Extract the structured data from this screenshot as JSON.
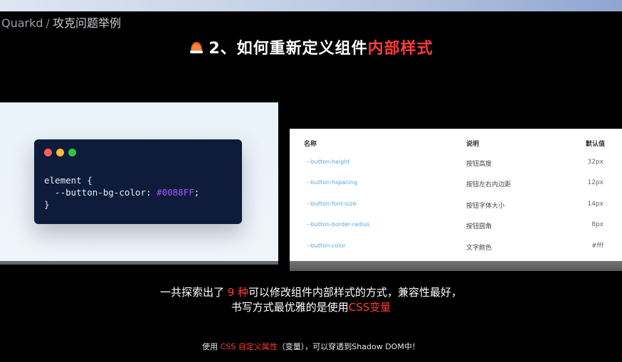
{
  "breadcrumb": {
    "root": "Quarkd",
    "separator": "/",
    "current": "攻克问题举例"
  },
  "title": {
    "prefix": "2、如何重新定义组件",
    "highlight": "内部样式"
  },
  "code_card": {
    "line1": "element {",
    "line2_prop": "  --button-bg-color: ",
    "line2_value": "#0088FF",
    "line2_end": ";",
    "line3": "}"
  },
  "table": {
    "headers": {
      "name": "名称",
      "desc": "说明",
      "default": "默认值"
    },
    "rows": [
      {
        "name": "--button-height",
        "desc": "按钮高度",
        "default": "32px"
      },
      {
        "name": "--button-hspacing",
        "desc": "按钮左右内边距",
        "default": "12px"
      },
      {
        "name": "--button-font-size",
        "desc": "按钮字体大小",
        "default": "14px"
      },
      {
        "name": "--button-border-radius",
        "desc": "按钮圆角",
        "default": "8px"
      },
      {
        "name": "--button-color",
        "desc": "文字颜色",
        "default": "#fff"
      }
    ]
  },
  "subtitle": {
    "line1_a": "一共探索出了 ",
    "line1_highlight": "9 种",
    "line1_b": "可以修改组件内部样式的方式，兼容性最好，",
    "line2_a": "书写方式最优雅的是使用",
    "line2_highlight": "CSS变量"
  },
  "caption": {
    "a": "使用 ",
    "highlight": "CSS 自定义属性",
    "b": "（变量），可以穿透到Shadow DOM中！"
  },
  "colors": {
    "accent": "#ff3b3b",
    "code_bg": "#0e1b3a",
    "code_hex": "#a855f7",
    "link": "#53a8e6"
  }
}
